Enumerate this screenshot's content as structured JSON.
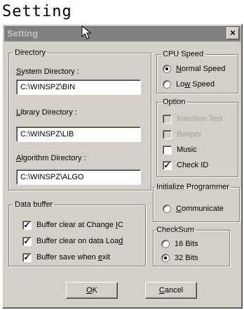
{
  "caption": "Setting",
  "window": {
    "title": "Setting",
    "close": "×"
  },
  "directory": {
    "legend": "Directory",
    "system": {
      "label_u": "S",
      "label_rest": "ystem Directory :",
      "value": "C:\\WINSPZ\\BIN"
    },
    "library": {
      "label_u": "L",
      "label_rest": "ibrary Directory :",
      "value": "C:\\WINSPZ\\LIB"
    },
    "algorithm": {
      "label_u": "A",
      "label_rest": "lgorithm Directory :",
      "value": "C:\\WINSPZ\\ALGO"
    }
  },
  "cpu_speed": {
    "legend": "CPU Speed",
    "normal": {
      "pre": "",
      "u": "N",
      "post": "ormal Speed",
      "selected": true
    },
    "low": {
      "pre": "Lo",
      "u": "w",
      "post": " Speed",
      "selected": false
    }
  },
  "option": {
    "legend": "Option",
    "insertion_test": {
      "label": "Insertion Test",
      "checked": false,
      "enabled": false
    },
    "beeper": {
      "label": "Beeper",
      "checked": false,
      "enabled": false
    },
    "music": {
      "label": "Music",
      "checked": false,
      "enabled": true
    },
    "check_id": {
      "label": "Check ID",
      "checked": true,
      "enabled": true
    }
  },
  "initialize": {
    "legend": "Initialize Programmer",
    "communicate": {
      "pre": "",
      "u": "C",
      "post": "ommunicate",
      "selected": false
    }
  },
  "data_buffer": {
    "legend": "Data buffer",
    "clear_change": {
      "pre": "Buffer clear at Change ",
      "u": "I",
      "post": "C",
      "checked": true
    },
    "clear_load": {
      "pre": "Buffer clear on data Loa",
      "u": "d",
      "post": "",
      "checked": true
    },
    "save_exit": {
      "pre": "Buffer save when ",
      "u": "e",
      "post": "xit",
      "checked": true
    }
  },
  "checksum": {
    "legend": "CheckSum",
    "bits16": {
      "label": "16 Bits",
      "selected": false
    },
    "bits32": {
      "label": "32 Bits",
      "selected": true
    }
  },
  "buttons": {
    "ok": {
      "u": "O",
      "rest": "K"
    },
    "cancel": {
      "u": "C",
      "rest": "ancel"
    }
  }
}
